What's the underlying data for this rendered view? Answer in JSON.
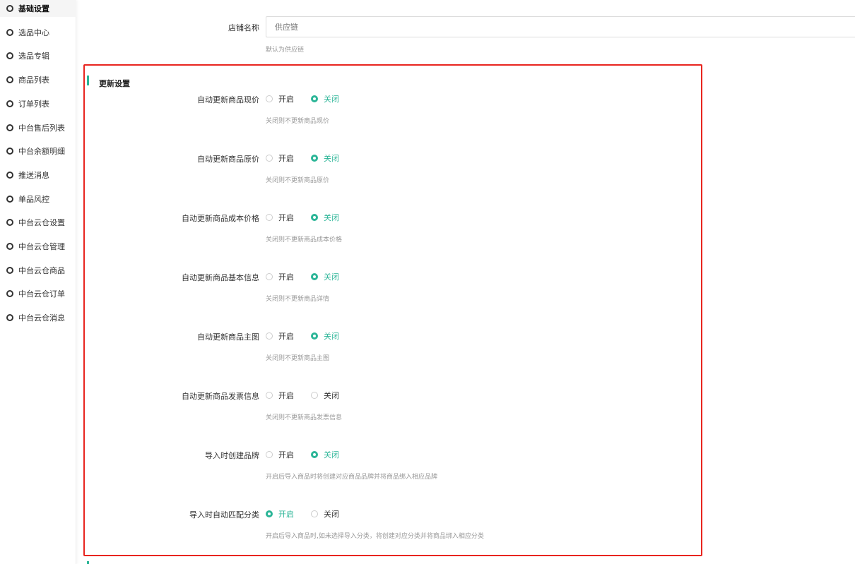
{
  "sidebar": {
    "items": [
      {
        "label": "基础设置",
        "active": true
      },
      {
        "label": "选品中心"
      },
      {
        "label": "选品专辑"
      },
      {
        "label": "商品列表"
      },
      {
        "label": "订单列表"
      },
      {
        "label": "中台售后列表"
      },
      {
        "label": "中台余额明细"
      },
      {
        "label": "推送消息"
      },
      {
        "label": "单品风控"
      },
      {
        "label": "中台云仓设置"
      },
      {
        "label": "中台云仓管理"
      },
      {
        "label": "中台云仓商品"
      },
      {
        "label": "中台云仓订单"
      },
      {
        "label": "中台云仓消息"
      }
    ]
  },
  "shop": {
    "label": "店铺名称",
    "placeholder": "供应链",
    "hint": "默认为供应链"
  },
  "update_section": {
    "title": "更新设置",
    "options": [
      "开启",
      "关闭"
    ],
    "settings": [
      {
        "label": "自动更新商品现价",
        "value": "关闭",
        "hint": "关闭则不更新商品现价"
      },
      {
        "label": "自动更新商品原价",
        "value": "关闭",
        "hint": "关闭则不更新商品原价"
      },
      {
        "label": "自动更新商品成本价格",
        "value": "关闭",
        "hint": "关闭则不更新商品成本价格"
      },
      {
        "label": "自动更新商品基本信息",
        "value": "关闭",
        "hint": "关闭则不更新商品详情"
      },
      {
        "label": "自动更新商品主图",
        "value": "关闭",
        "hint": "关闭则不更新商品主图"
      },
      {
        "label": "自动更新商品发票信息",
        "value": "",
        "hint": "关闭则不更新商品发票信息"
      },
      {
        "label": "导入时创建品牌",
        "value": "关闭",
        "hint": "开启后导入商品时将创建对应商品品牌并将商品绑入相应品牌"
      },
      {
        "label": "导入时自动匹配分类",
        "value": "开启",
        "hint": "开启后导入商品时,如未选择导入分类，将创建对应分类并将商品绑入相应分类"
      }
    ]
  },
  "colors": {
    "accent": "#2bb597",
    "highlight_border": "#e8251f"
  }
}
